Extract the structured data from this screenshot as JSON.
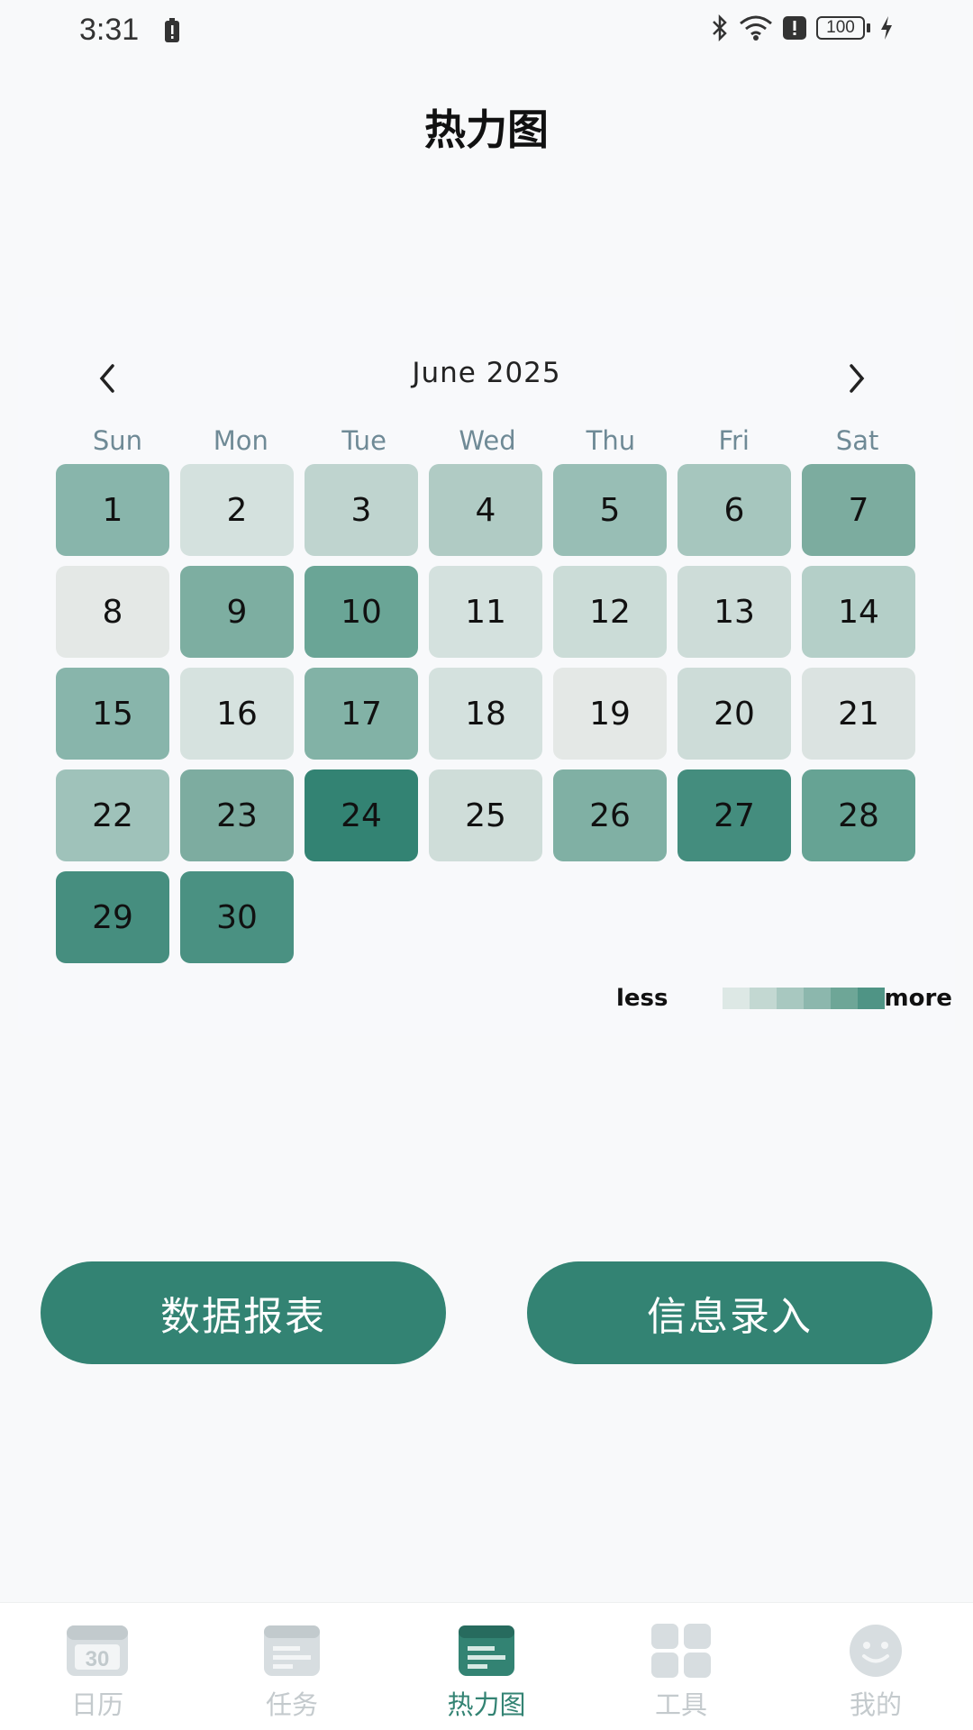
{
  "status_bar": {
    "time": "3:31",
    "battery": "100"
  },
  "header": {
    "title": "热力图"
  },
  "calendar": {
    "month_label": "June 2025",
    "weekdays": [
      "Sun",
      "Mon",
      "Tue",
      "Wed",
      "Thu",
      "Fri",
      "Sat"
    ],
    "days": [
      {
        "label": "1",
        "color": "#88b5ab"
      },
      {
        "label": "2",
        "color": "#d4e1de"
      },
      {
        "label": "3",
        "color": "#bfd4cf"
      },
      {
        "label": "4",
        "color": "#b0cbc4"
      },
      {
        "label": "5",
        "color": "#98beb5"
      },
      {
        "label": "6",
        "color": "#a6c6be"
      },
      {
        "label": "7",
        "color": "#7cac9f"
      },
      {
        "label": "8",
        "color": "#e4e8e6"
      },
      {
        "label": "9",
        "color": "#7dae a1"
      },
      {
        "label": "10",
        "color": "#6aa596"
      },
      {
        "label": "11",
        "color": "#d4e1de"
      },
      {
        "label": "12",
        "color": "#cbdcd7"
      },
      {
        "label": "13",
        "color": "#cddcd8"
      },
      {
        "label": "14",
        "color": "#b4cfc8"
      },
      {
        "label": "15",
        "color": "#88b5ab"
      },
      {
        "label": "16",
        "color": "#d6e2df"
      },
      {
        "label": "17",
        "color": "#82b2a6"
      },
      {
        "label": "18",
        "color": "#d4e1de"
      },
      {
        "label": "19",
        "color": "#e4e8e6"
      },
      {
        "label": "20",
        "color": "#cddcd8"
      },
      {
        "label": "21",
        "color": "#dbe3e1"
      },
      {
        "label": "22",
        "color": "#9fc2ba"
      },
      {
        "label": "23",
        "color": "#7dac a0"
      },
      {
        "label": "24",
        "color": "#338373"
      },
      {
        "label": "25",
        "color": "#cfddd9"
      },
      {
        "label": "26",
        "color": "#80b0a4"
      },
      {
        "label": "27",
        "color": "#448d7e"
      },
      {
        "label": "28",
        "color": "#66a394"
      },
      {
        "label": "29",
        "color": "#468e7f"
      },
      {
        "label": "30",
        "color": "#4a9182"
      }
    ]
  },
  "legend": {
    "less_label": "less",
    "more_label": "more",
    "swatches": [
      "#f8f9fb",
      "#dde8e5",
      "#c3d8d2",
      "#a8c8c0",
      "#8cb7ad",
      "#6ea697",
      "#4f9485"
    ]
  },
  "actions": {
    "report_label": "数据报表",
    "entry_label": "信息录入"
  },
  "tabs": [
    {
      "label": "日历",
      "icon": "calendar-icon"
    },
    {
      "label": "任务",
      "icon": "task-icon"
    },
    {
      "label": "热力图",
      "icon": "heatmap-icon"
    },
    {
      "label": "工具",
      "icon": "grid-tools-icon"
    },
    {
      "label": "我的",
      "icon": "smiley-profile-icon"
    }
  ],
  "colors": {
    "accent": "#338373",
    "tab_inactive": "#c4cacd"
  }
}
